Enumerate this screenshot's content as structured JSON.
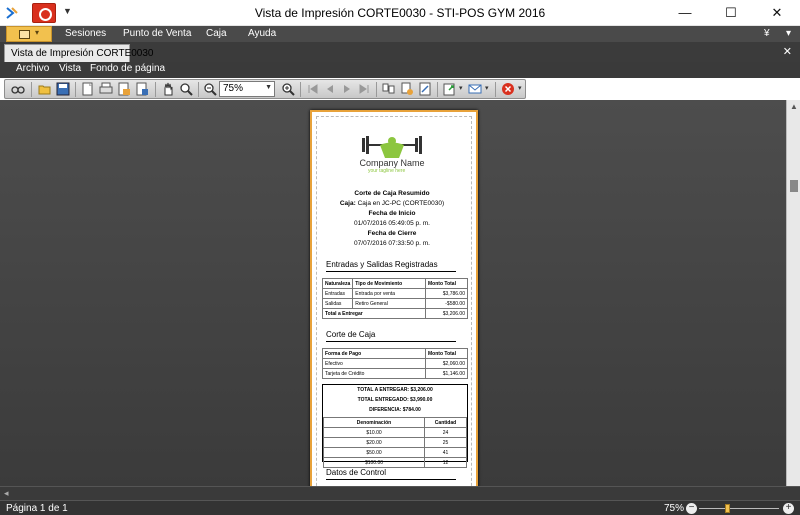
{
  "window": {
    "title": "Vista de Impresión CORTE0030 - STI-POS GYM 2016",
    "controls": [
      "—",
      "☐",
      "✕"
    ]
  },
  "ribbon": {
    "menu": [
      "Sesiones",
      "Punto de Venta",
      "Caja",
      "Ayuda"
    ]
  },
  "document_tab": {
    "label": "Vista de Impresión CORTE0030",
    "close": "✕"
  },
  "doc_menu": [
    "Archivo",
    "Vista",
    "Fondo de página"
  ],
  "toolbar": {
    "zoom_value": "75%",
    "icons": [
      "find-icon",
      "open-icon",
      "save-icon",
      "page-setup-icon",
      "print-icon",
      "print-quick-icon",
      "watermark-icon",
      "hand-tool-icon",
      "magnifier-icon",
      "zoom-out-icon",
      "zoom-in-icon",
      "first-page-icon",
      "prev-page-icon",
      "next-page-icon",
      "last-page-icon",
      "multipage-icon",
      "color-icon",
      "scale-icon",
      "export-icon",
      "send-email-icon",
      "close-preview-icon"
    ]
  },
  "report": {
    "logo_name": "Company Name",
    "logo_tagline": "your tagline here",
    "header": {
      "title": "Corte de Caja Resumido",
      "caja_label": "Caja:",
      "caja_value": "Caja en JC-PC (CORTE0030)",
      "fecha_inicio_label": "Fecha de Inicio",
      "fecha_inicio": "01/07/2016 05:49:05 p. m.",
      "fecha_cierre_label": "Fecha de Cierre",
      "fecha_cierre": "07/07/2016 07:33:50 p. m."
    },
    "entradas": {
      "section_title": "Entradas y Salidas Registradas",
      "columns": [
        "Naturaleza",
        "Tipo de Movimiento",
        "Monto Total"
      ],
      "rows": [
        [
          "Entradas",
          "Entrada por venta",
          "$3,786.00"
        ],
        [
          "Salidas",
          "Retiro General",
          "-$580.00"
        ]
      ],
      "total_label": "Total a Entregar",
      "total_value": "$3,206.00"
    },
    "corte": {
      "section_title": "Corte de Caja",
      "columns": [
        "Forma de Pago",
        "Monto Total"
      ],
      "rows": [
        [
          "Efectivo",
          "$2,060.00"
        ],
        [
          "Tarjeta de Crédito",
          "$1,146.00"
        ]
      ],
      "total_a_entregar": "TOTAL A ENTREGAR: $3,206.00",
      "total_entregado": "TOTAL ENTREGADO: $3,990.00",
      "diferencia": "DIFERENCIA: $784.00",
      "denom_columns": [
        "Denominación",
        "Cantidad"
      ],
      "denominaciones": [
        [
          "$10.00",
          "24"
        ],
        [
          "$20.00",
          "25"
        ],
        [
          "$50.00",
          "41"
        ],
        [
          "$100.00",
          "12"
        ]
      ]
    },
    "control": {
      "section_title": "Datos de Control"
    }
  },
  "statusbar": {
    "page": "Página 1 de 1",
    "zoom": "75%",
    "zoom_level_percent": 75,
    "zoom_out": "−",
    "zoom_in": "+"
  },
  "colors": {
    "page_border": "#e8a23a",
    "accent": "#f2c14e",
    "logo_green": "#8cc63f"
  }
}
